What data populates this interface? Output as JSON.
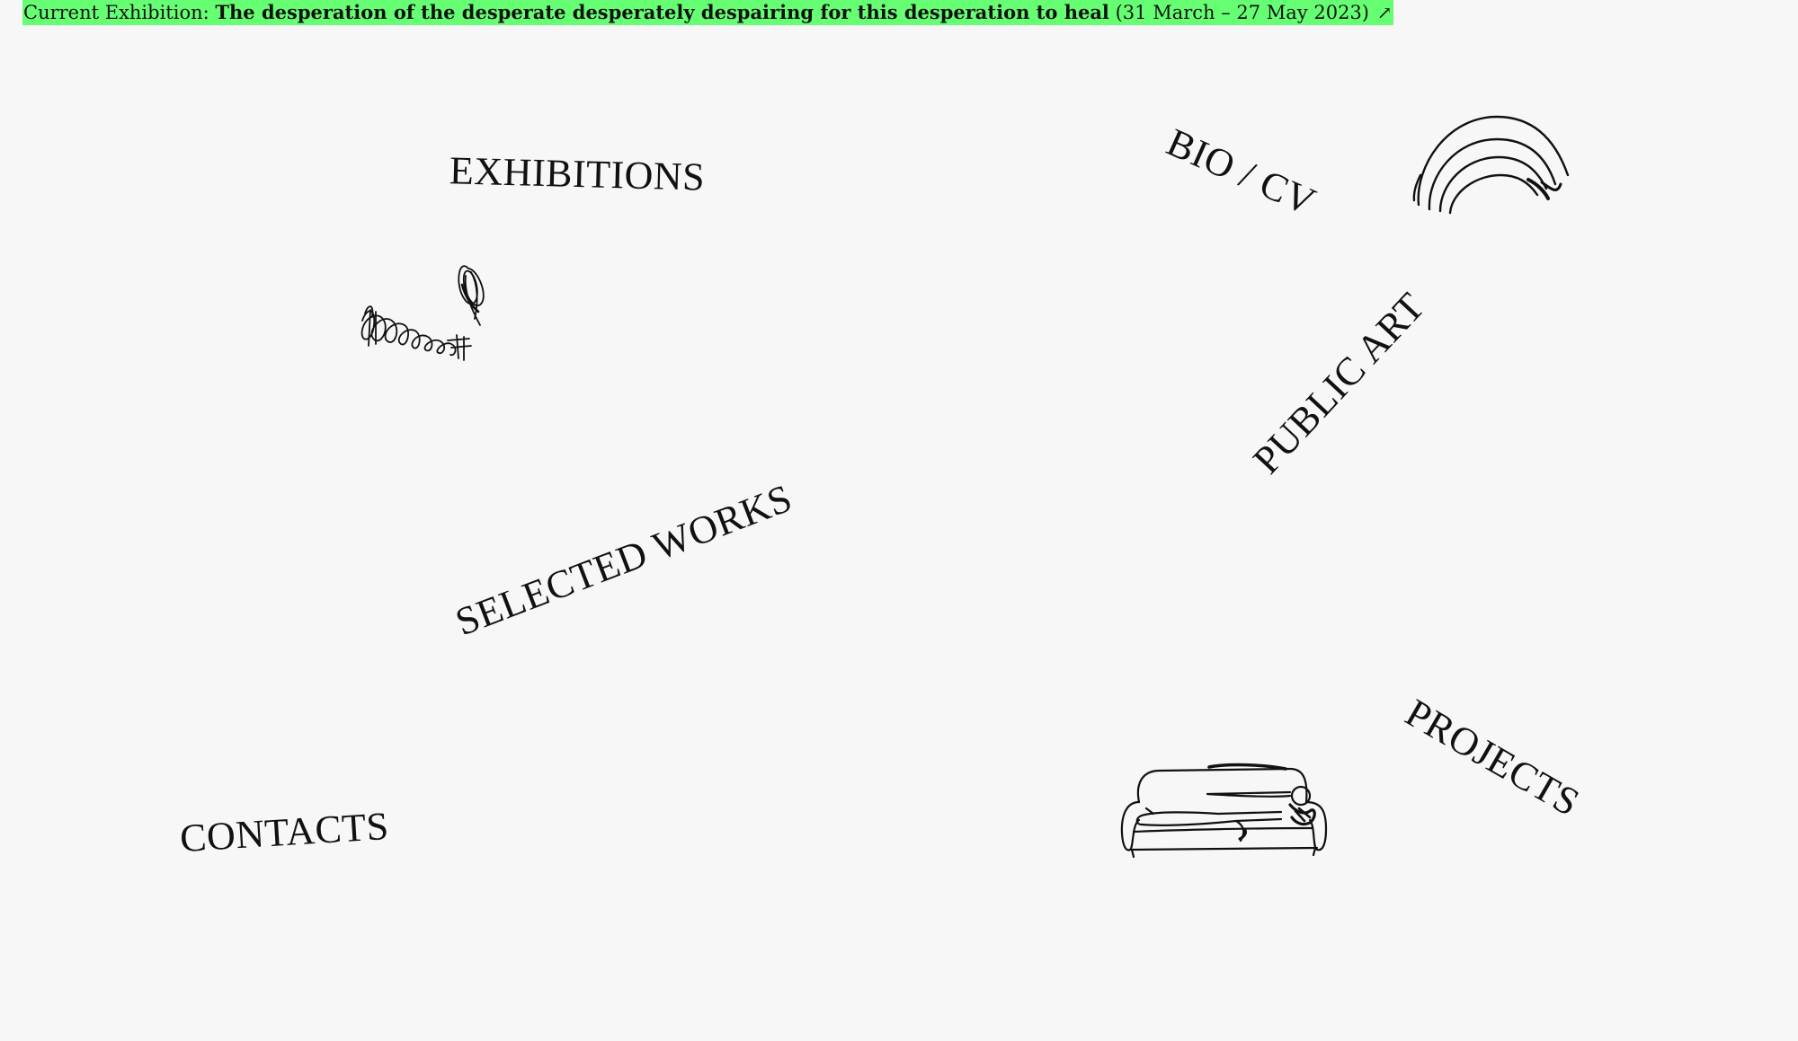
{
  "banner": {
    "prefix": "Current Exhibition:",
    "title": "The desperation of the desperate desperately despairing for this desperation to heal",
    "dates": "(31 March – 27 May 2023)",
    "arrow_icon": "external-link-arrow-icon",
    "background_color": "#66ff73"
  },
  "nav": {
    "exhibitions": "EXHIBITIONS",
    "bio_cv": "BIO / CV",
    "public_art": "PUBLIC ART",
    "selected_works": "SELECTED WORKS",
    "contacts": "CONTACTS",
    "projects": "PROJECTS"
  },
  "doodles": {
    "rainbow": "rainbow-drawing-icon",
    "scribble": "scribble-drawing-icon",
    "sofa": "person-on-sofa-drawing-icon"
  },
  "colors": {
    "background": "#f7f7f7",
    "text": "#111111",
    "accent": "#66ff73"
  }
}
